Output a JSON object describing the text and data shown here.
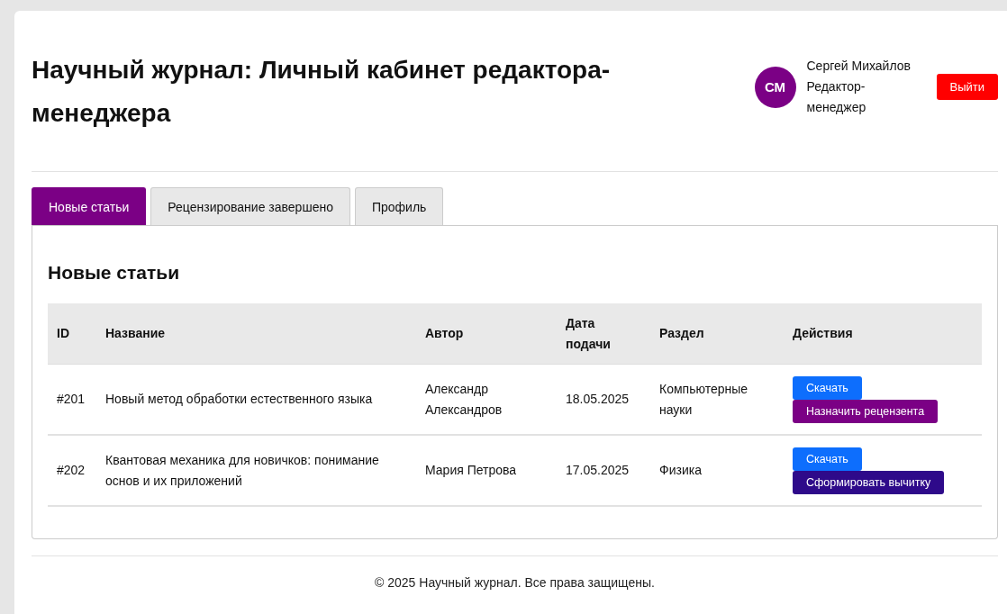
{
  "header": {
    "title": "Научный журнал: Личный кабинет редактора-менеджера",
    "user": {
      "initials": "СМ",
      "name": "Сергей Михайлов",
      "role": "Редактор-менеджер"
    },
    "logout": "Выйти"
  },
  "tabs": [
    {
      "label": "Новые статьи",
      "selected": true
    },
    {
      "label": "Рецензирование завершено",
      "selected": false
    },
    {
      "label": "Профиль",
      "selected": false
    }
  ],
  "section_title": "Новые статьи",
  "table": {
    "columns": [
      "ID",
      "Название",
      "Автор",
      "Дата подачи",
      "Раздел",
      "Действия"
    ],
    "rows": [
      {
        "id": "#201",
        "title": "Новый метод обработки естественного языка",
        "author": "Александр Александров",
        "date": "18.05.2025",
        "section": "Компьютерные науки",
        "actions": [
          {
            "kind": "download",
            "label": "Скачать"
          },
          {
            "kind": "assign",
            "label": "Назначить рецензента"
          }
        ]
      },
      {
        "id": "#202",
        "title": "Квантовая механика для новичков: понимание основ и их приложений",
        "author": "Мария Петрова",
        "date": "17.05.2025",
        "section": "Физика",
        "actions": [
          {
            "kind": "download",
            "label": "Скачать"
          },
          {
            "kind": "proofread",
            "label": "Сформировать вычитку"
          }
        ]
      }
    ]
  },
  "footer": "© 2025 Научный журнал. Все права защищены."
}
